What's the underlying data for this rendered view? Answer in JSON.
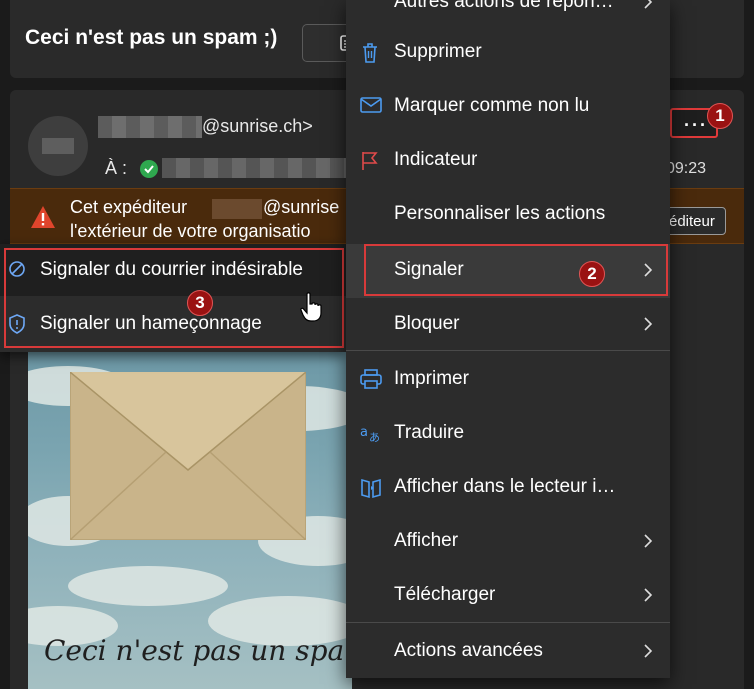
{
  "subject": {
    "title": "Ceci n'est pas un spam ;)"
  },
  "email": {
    "sender_domain": "@sunrise.ch>",
    "to_label": "À :",
    "time": "09:23",
    "more_button": "···"
  },
  "warning": {
    "line1_prefix": "Cet expéditeur",
    "line1_domain": "@sunrise",
    "line2": "l'extérieur de votre organisatio",
    "button_label": "éditeur"
  },
  "image": {
    "caption": "Ceci n'est pas un spam"
  },
  "submenu": {
    "items": [
      {
        "label": "Signaler du courrier indésirable",
        "icon": "block-icon"
      },
      {
        "label": "Signaler un hameçonnage",
        "icon": "shield-icon"
      }
    ]
  },
  "menu": {
    "items": [
      {
        "label": "Autres actions de répon…",
        "icon": ""
      },
      {
        "label": "Supprimer",
        "icon": "trash-icon"
      },
      {
        "label": "Marquer comme non lu",
        "icon": "envelope-icon"
      },
      {
        "label": "Indicateur",
        "icon": "flag-icon"
      },
      {
        "label": "Personnaliser les actions",
        "icon": ""
      },
      {
        "label": "Signaler",
        "icon": ""
      },
      {
        "label": "Bloquer",
        "icon": ""
      },
      {
        "label": "Imprimer",
        "icon": "printer-icon"
      },
      {
        "label": "Traduire",
        "icon": "translate-icon"
      },
      {
        "label": "Afficher dans le lecteur i…",
        "icon": "immersive-reader-icon"
      },
      {
        "label": "Afficher",
        "icon": ""
      },
      {
        "label": "Télécharger",
        "icon": ""
      },
      {
        "label": "Actions avancées",
        "icon": ""
      }
    ]
  },
  "annotations": {
    "badge1": "1",
    "badge2": "2",
    "badge3": "3"
  },
  "colors": {
    "highlight": "#d83a3a",
    "badge": "#9a1212",
    "warning_bg": "#4a2a0c",
    "icon_blue": "#4c9bf0"
  }
}
